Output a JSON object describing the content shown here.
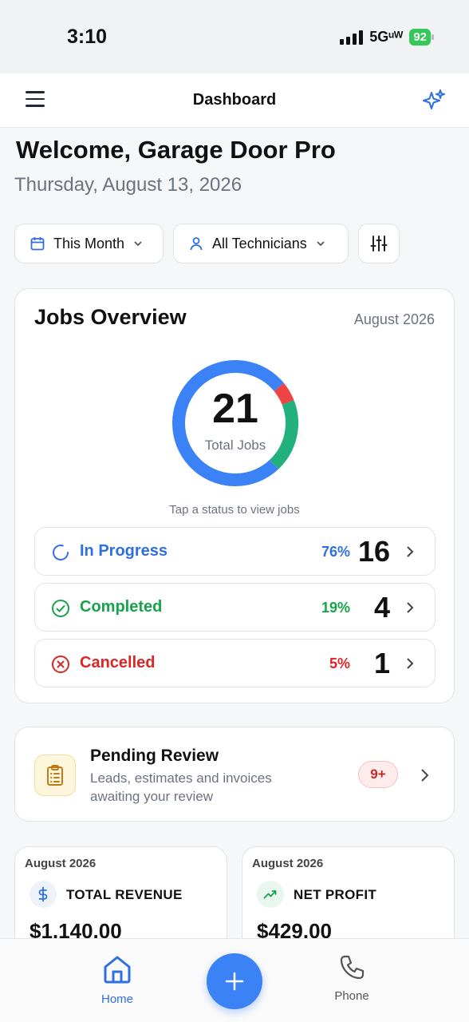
{
  "status_bar": {
    "time": "3:10",
    "network": "5Gᵘᵂ",
    "battery": "92"
  },
  "header": {
    "title": "Dashboard"
  },
  "welcome": {
    "title": "Welcome, Garage Door Pro",
    "date": "Thursday, August 13, 2026"
  },
  "filters": {
    "period": "This Month",
    "technicians": "All Technicians"
  },
  "jobs_overview": {
    "title": "Jobs Overview",
    "month": "August 2026",
    "total": "21",
    "total_label": "Total Jobs",
    "hint": "Tap a status to view jobs",
    "statuses": [
      {
        "label": "In Progress",
        "percent": "76%",
        "count": "16",
        "color": "#2f6fe0"
      },
      {
        "label": "Completed",
        "percent": "19%",
        "count": "4",
        "color": "#16a34a"
      },
      {
        "label": "Cancelled",
        "percent": "5%",
        "count": "1",
        "color": "#dc2626"
      }
    ],
    "donut_fractions": {
      "in_progress": 0.76,
      "completed": 0.19,
      "cancelled": 0.05
    }
  },
  "pending": {
    "title": "Pending Review",
    "description": "Leads, estimates and invoices awaiting your review",
    "badge": "9+"
  },
  "revenue": {
    "month": "August 2026",
    "label": "TOTAL REVENUE",
    "value": "$1,140.00"
  },
  "profit": {
    "month": "August 2026",
    "label": "NET PROFIT",
    "value": "$429.00"
  },
  "nav": {
    "home": "Home",
    "phone": "Phone"
  },
  "colors": {
    "accent": "#3b82f6",
    "in_progress": "#3b82f6",
    "completed": "#22b07d",
    "cancelled": "#ef4444"
  }
}
